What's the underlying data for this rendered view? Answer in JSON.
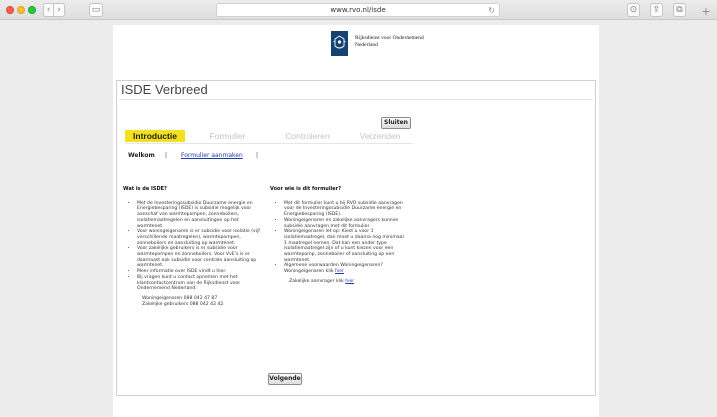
{
  "browser": {
    "url": "www.rvo.nl/isde",
    "buttons": {
      "back": "‹",
      "forward": "›",
      "sidebar": "▭",
      "reload": "↻",
      "downloads": "⊙",
      "share": "⇪",
      "tabs": "⧉",
      "new_tab": "+"
    }
  },
  "header": {
    "org_line1": "Rijksdienst voor Ondernemend",
    "org_line2": "Nederland",
    "logo_color": "#154273"
  },
  "app": {
    "title": "ISDE Verbreed",
    "close_label": "Sluiten",
    "next_label": "Volgende"
  },
  "steps": [
    {
      "label": "Introductie",
      "active": true
    },
    {
      "label": "Formulier",
      "active": false
    },
    {
      "label": "Controleren",
      "active": false
    },
    {
      "label": "Verzenden",
      "active": false
    }
  ],
  "subnav": {
    "welcome": "Welkom",
    "separator": "|",
    "link": "Formulier aanmaken"
  },
  "left_column": {
    "heading": "Wat is de ISDE?",
    "bullets": [
      "Met de Investeringssubsidie Duurzame energie en Energiebesparing (ISDE) is subsidie mogelijk voor aanschaf van warmtepompen, zonneboilers, isolatiemaatregelen en aansluitingen op het warmtenet.",
      "Voor woningeigenaren is er subsidie voor isolatie (vijf verschillende maatregelen), warmtepompen, zonneboilers en aansluiting op warmtenet.",
      "Voor zakelijke gebruikers is er subsidie voor warmtepompen en zonneboilers. Voor VvE's is er daarnaast ook subsidie voor centrale aansluiting op warmtenet.",
      "Meer informatie over ISDE vindt u hier.",
      "Bij vragen kunt u contact opnemen met het klantcontactcentrum van de Rijksdienst voor Ondernemend Nederland:"
    ],
    "phone_1": "Woningeigenaren 088 042 47 87",
    "phone_2": "Zakelijke gebruikers 088 042 42 42"
  },
  "right_column": {
    "heading": "Voor wie is dit formulier?",
    "bullets": [
      "Met dit formulier kunt u bij RVO subsidie aanvragen voor de Investeringssubsidie Duurzame energie en Energiebesparing (ISDE).",
      "Woningeigenaren en zakelijke aanvragers kunnen subsidie aanvragen met dit formulier.",
      "Woningeigenaren let op: Kiest u voor 1 isolatiemaatregel, dan moet u daarna nog minimaal 1 maatregel nemen. Dat kan een ander type isolatiemaatregel zijn of u kunt kiezen voor een warmtepomp, zonneboiler of aansluiting op een warmtenet.",
      "Algemene voorwaarden Woningeigenaren? Woningeigenaren klik"
    ],
    "bullet4_link": "hier",
    "business_line": "Zakelijke aanvrager klik",
    "business_link": "hier"
  }
}
